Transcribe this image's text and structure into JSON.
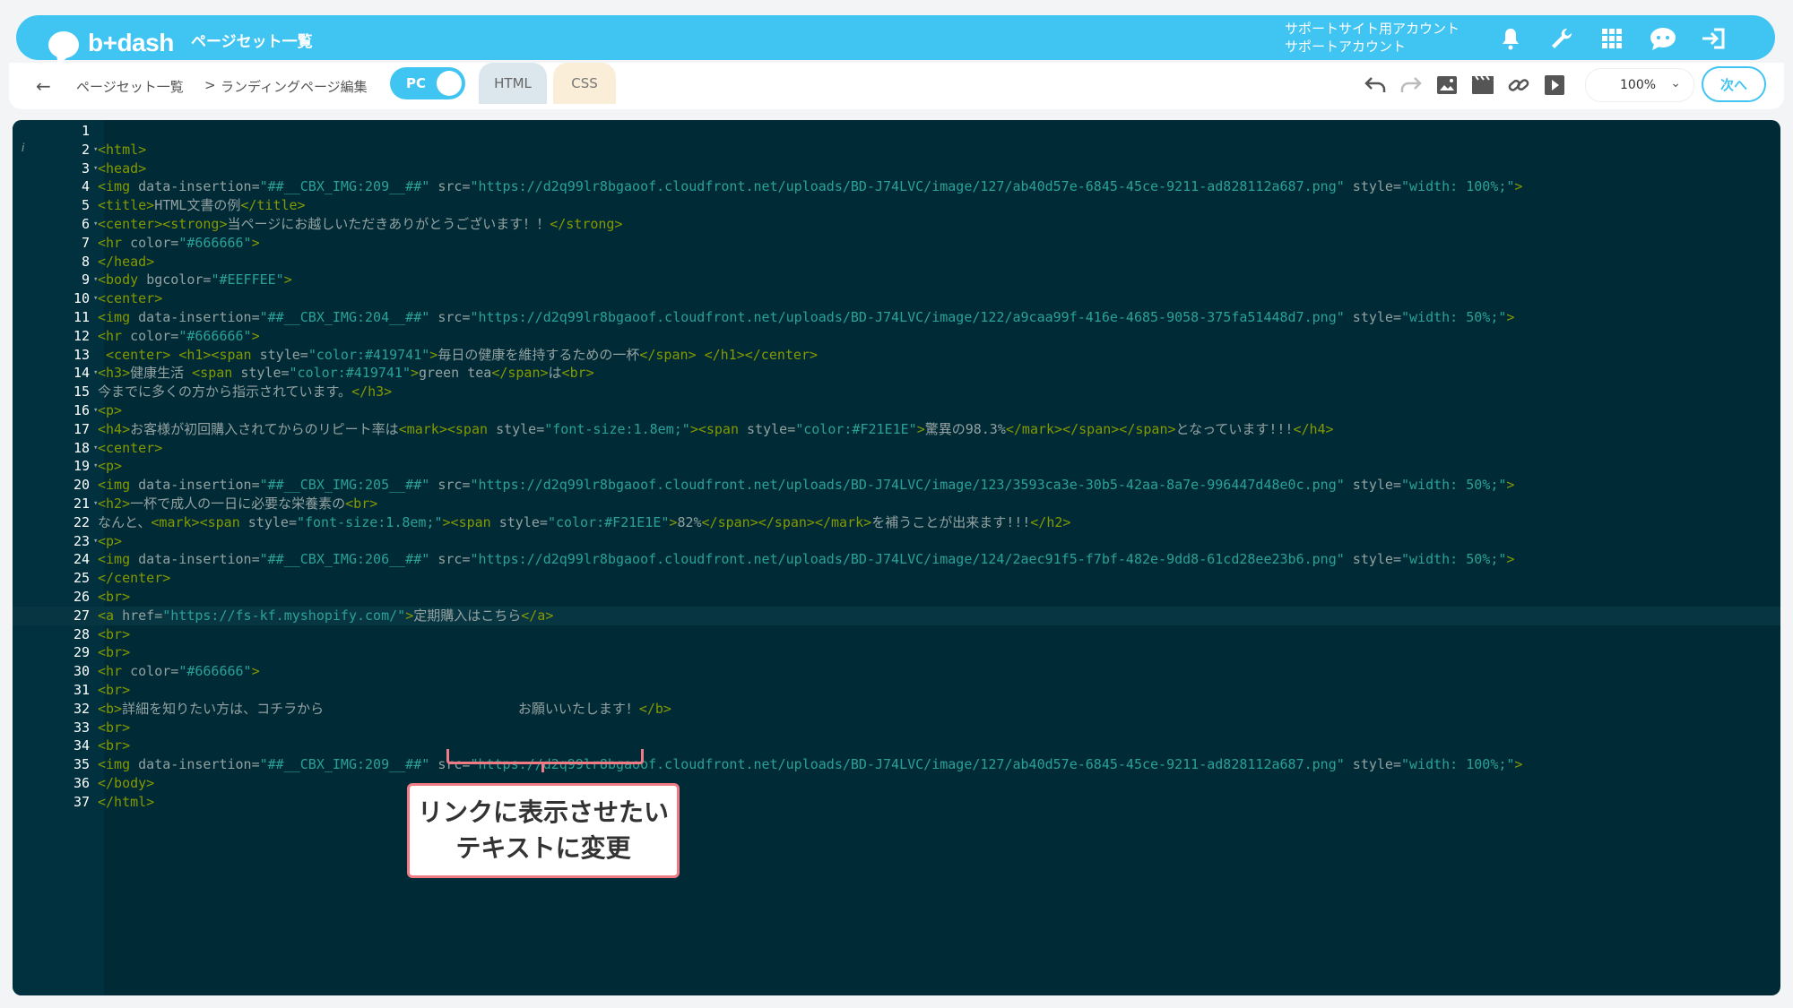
{
  "app": {
    "logo_text": "b+dash",
    "title": "ページセット一覧",
    "account_line1": "サポートサイト用アカウント",
    "account_line2": "サポートアカウント"
  },
  "topbar_icons": [
    "bell-icon",
    "wrench-icon",
    "grid-icon",
    "chat-icon",
    "logout-icon"
  ],
  "breadcrumb": {
    "back_label": "←",
    "item1": "ページセット一覧",
    "separator": ">",
    "item2": "ランディングページ編集"
  },
  "device_toggle": {
    "label": "PC",
    "on": true
  },
  "tabs": {
    "html": "HTML",
    "css": "CSS",
    "active": "HTML"
  },
  "toolbar_icons": [
    "undo-icon",
    "redo-icon",
    "image-icon",
    "video-icon",
    "link-icon",
    "play-icon"
  ],
  "zoom": {
    "value": "100%"
  },
  "next_button": "次へ",
  "callout": {
    "line1": "リンクに表示させたい",
    "line2": "テキストに変更"
  },
  "editor": {
    "active_line": 27,
    "lines": [
      [],
      [
        [
          "t",
          "<html>"
        ]
      ],
      [
        [
          "t",
          "<head>"
        ]
      ],
      [
        [
          "t",
          "<img "
        ],
        [
          "a",
          "data-insertion"
        ],
        [
          "x",
          "="
        ],
        [
          "s",
          "\"##__CBX_IMG:209__##\""
        ],
        [
          "x",
          " "
        ],
        [
          "a",
          "src"
        ],
        [
          "x",
          "="
        ],
        [
          "s",
          "\"https://d2q99lr8bgaoof.cloudfront.net/uploads/BD-J74LVC/image/127/ab40d57e-6845-45ce-9211-ad828112a687.png\""
        ],
        [
          "x",
          " "
        ],
        [
          "a",
          "style"
        ],
        [
          "x",
          "="
        ],
        [
          "s",
          "\"width: 100%;\""
        ],
        [
          "t",
          ">"
        ]
      ],
      [
        [
          "t",
          "<title>"
        ],
        [
          "x",
          "HTML文書の例"
        ],
        [
          "t",
          "</title>"
        ]
      ],
      [
        [
          "t",
          "<center><strong>"
        ],
        [
          "x",
          "当ページにお越しいただきありがとうございます！！"
        ],
        [
          "t",
          "</strong>"
        ]
      ],
      [
        [
          "t",
          "<hr "
        ],
        [
          "a",
          "color"
        ],
        [
          "x",
          "="
        ],
        [
          "s",
          "\"#666666\""
        ],
        [
          "t",
          ">"
        ]
      ],
      [
        [
          "t",
          "</head>"
        ]
      ],
      [
        [
          "t",
          "<body "
        ],
        [
          "a",
          "bgcolor"
        ],
        [
          "x",
          "="
        ],
        [
          "s",
          "\"#EEFFEE\""
        ],
        [
          "t",
          ">"
        ]
      ],
      [
        [
          "t",
          "<center>"
        ]
      ],
      [
        [
          "t",
          "<img "
        ],
        [
          "a",
          "data-insertion"
        ],
        [
          "x",
          "="
        ],
        [
          "s",
          "\"##__CBX_IMG:204__##\""
        ],
        [
          "x",
          " "
        ],
        [
          "a",
          "src"
        ],
        [
          "x",
          "="
        ],
        [
          "s",
          "\"https://d2q99lr8bgaoof.cloudfront.net/uploads/BD-J74LVC/image/122/a9caa99f-416e-4685-9058-375fa51448d7.png\""
        ],
        [
          "x",
          " "
        ],
        [
          "a",
          "style"
        ],
        [
          "x",
          "="
        ],
        [
          "s",
          "\"width: 50%;\""
        ],
        [
          "t",
          ">"
        ]
      ],
      [
        [
          "t",
          "<hr "
        ],
        [
          "a",
          "color"
        ],
        [
          "x",
          "="
        ],
        [
          "s",
          "\"#666666\""
        ],
        [
          "t",
          ">"
        ]
      ],
      [
        [
          "x",
          " "
        ],
        [
          "t",
          "<center>"
        ],
        [
          "x",
          " "
        ],
        [
          "t",
          "<h1><span "
        ],
        [
          "a",
          "style"
        ],
        [
          "x",
          "="
        ],
        [
          "s",
          "\"color:#419741\""
        ],
        [
          "t",
          ">"
        ],
        [
          "x",
          "毎日の健康を維持するための一杯"
        ],
        [
          "t",
          "</span>"
        ],
        [
          "x",
          " "
        ],
        [
          "t",
          "</h1></center>"
        ]
      ],
      [
        [
          "t",
          "<h3>"
        ],
        [
          "x",
          "健康生活 "
        ],
        [
          "t",
          "<span "
        ],
        [
          "a",
          "style"
        ],
        [
          "x",
          "="
        ],
        [
          "s",
          "\"color:#419741\""
        ],
        [
          "t",
          ">"
        ],
        [
          "x",
          "green tea"
        ],
        [
          "t",
          "</span>"
        ],
        [
          "x",
          "は"
        ],
        [
          "t",
          "<br>"
        ]
      ],
      [
        [
          "x",
          "今までに多くの方から指示されています。"
        ],
        [
          "t",
          "</h3>"
        ]
      ],
      [
        [
          "t",
          "<p>"
        ]
      ],
      [
        [
          "t",
          "<h4>"
        ],
        [
          "x",
          "お客様が初回購入されてからのリピート率は"
        ],
        [
          "t",
          "<mark><span "
        ],
        [
          "a",
          "style"
        ],
        [
          "x",
          "="
        ],
        [
          "s",
          "\"font-size:1.8em;\""
        ],
        [
          "t",
          "><span "
        ],
        [
          "a",
          "style"
        ],
        [
          "x",
          "="
        ],
        [
          "s",
          "\"color:#F21E1E\""
        ],
        [
          "t",
          ">"
        ],
        [
          "x",
          "驚異の98.3%"
        ],
        [
          "t",
          "</mark></span></span>"
        ],
        [
          "x",
          "となっています!!!"
        ],
        [
          "t",
          "</h4>"
        ]
      ],
      [
        [
          "t",
          "<center>"
        ]
      ],
      [
        [
          "t",
          "<p>"
        ]
      ],
      [
        [
          "t",
          "<img "
        ],
        [
          "a",
          "data-insertion"
        ],
        [
          "x",
          "="
        ],
        [
          "s",
          "\"##__CBX_IMG:205__##\""
        ],
        [
          "x",
          " "
        ],
        [
          "a",
          "src"
        ],
        [
          "x",
          "="
        ],
        [
          "s",
          "\"https://d2q99lr8bgaoof.cloudfront.net/uploads/BD-J74LVC/image/123/3593ca3e-30b5-42aa-8a7e-996447d48e0c.png\""
        ],
        [
          "x",
          " "
        ],
        [
          "a",
          "style"
        ],
        [
          "x",
          "="
        ],
        [
          "s",
          "\"width: 50%;\""
        ],
        [
          "t",
          ">"
        ]
      ],
      [
        [
          "t",
          "<h2>"
        ],
        [
          "x",
          "一杯で成人の一日に必要な栄養素の"
        ],
        [
          "t",
          "<br>"
        ]
      ],
      [
        [
          "x",
          "なんと、"
        ],
        [
          "t",
          "<mark><span "
        ],
        [
          "a",
          "style"
        ],
        [
          "x",
          "="
        ],
        [
          "s",
          "\"font-size:1.8em;\""
        ],
        [
          "t",
          "><span "
        ],
        [
          "a",
          "style"
        ],
        [
          "x",
          "="
        ],
        [
          "s",
          "\"color:#F21E1E\""
        ],
        [
          "t",
          ">"
        ],
        [
          "x",
          "82%"
        ],
        [
          "t",
          "</span></span></mark>"
        ],
        [
          "x",
          "を補うことが出来ます!!!"
        ],
        [
          "t",
          "</h2>"
        ]
      ],
      [
        [
          "t",
          "<p>"
        ]
      ],
      [
        [
          "t",
          "<img "
        ],
        [
          "a",
          "data-insertion"
        ],
        [
          "x",
          "="
        ],
        [
          "s",
          "\"##__CBX_IMG:206__##\""
        ],
        [
          "x",
          " "
        ],
        [
          "a",
          "src"
        ],
        [
          "x",
          "="
        ],
        [
          "s",
          "\"https://d2q99lr8bgaoof.cloudfront.net/uploads/BD-J74LVC/image/124/2aec91f5-f7bf-482e-9dd8-61cd28ee23b6.png\""
        ],
        [
          "x",
          " "
        ],
        [
          "a",
          "style"
        ],
        [
          "x",
          "="
        ],
        [
          "s",
          "\"width: 50%;\""
        ],
        [
          "t",
          ">"
        ]
      ],
      [
        [
          "t",
          "</center>"
        ]
      ],
      [
        [
          "t",
          "<br>"
        ]
      ],
      [
        [
          "t",
          "<a "
        ],
        [
          "a",
          "href"
        ],
        [
          "x",
          "="
        ],
        [
          "s",
          "\"https://fs-kf.myshopify.com/\""
        ],
        [
          "t",
          ">"
        ],
        [
          "x",
          "定期購入はこちら"
        ],
        [
          "t",
          "</a>"
        ]
      ],
      [
        [
          "t",
          "<br>"
        ]
      ],
      [
        [
          "t",
          "<br>"
        ]
      ],
      [
        [
          "t",
          "<hr "
        ],
        [
          "a",
          "color"
        ],
        [
          "x",
          "="
        ],
        [
          "s",
          "\"#666666\""
        ],
        [
          "t",
          ">"
        ]
      ],
      [
        [
          "t",
          "<br>"
        ]
      ],
      [
        [
          "t",
          "<b>"
        ],
        [
          "x",
          "詳細を知りたい方は、コチラから                        お願いいたします！"
        ],
        [
          "t",
          "</b>"
        ]
      ],
      [
        [
          "t",
          "<br>"
        ]
      ],
      [
        [
          "t",
          "<br>"
        ]
      ],
      [
        [
          "t",
          "<img "
        ],
        [
          "a",
          "data-insertion"
        ],
        [
          "x",
          "="
        ],
        [
          "s",
          "\"##__CBX_IMG:209__##\""
        ],
        [
          "x",
          " "
        ],
        [
          "a",
          "src"
        ],
        [
          "x",
          "="
        ],
        [
          "s",
          "\"https://d2q99lr8bgaoof.cloudfront.net/uploads/BD-J74LVC/image/127/ab40d57e-6845-45ce-9211-ad828112a687.png\""
        ],
        [
          "x",
          " "
        ],
        [
          "a",
          "style"
        ],
        [
          "x",
          "="
        ],
        [
          "s",
          "\"width: 100%;\""
        ],
        [
          "t",
          ">"
        ]
      ],
      [
        [
          "t",
          "</body>"
        ]
      ],
      [
        [
          "t",
          "</html>"
        ]
      ]
    ],
    "foldable": [
      2,
      3,
      6,
      9,
      10,
      14,
      16,
      18,
      19,
      21,
      23
    ]
  }
}
